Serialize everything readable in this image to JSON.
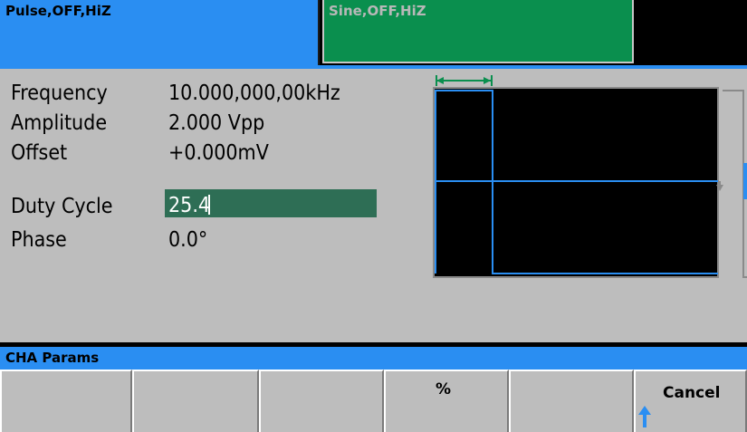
{
  "channels": {
    "cha_status": "Pulse,OFF,HiZ",
    "chb_status": "Sine,OFF,HiZ"
  },
  "params": {
    "frequency_label": "Frequency",
    "frequency_value": "10.000,000,00kHz",
    "amplitude_label": "Amplitude",
    "amplitude_value": "2.000 Vpp",
    "offset_label": "Offset",
    "offset_value": "+0.000mV",
    "duty_label": "Duty Cycle",
    "duty_value": "25.4",
    "phase_label": "Phase",
    "phase_value": "0.0°"
  },
  "menu": {
    "title": "CHA Params",
    "softkeys": [
      "",
      "",
      "",
      "%",
      "",
      "Cancel"
    ]
  },
  "colors": {
    "cha_blue": "#2a8ef2",
    "chb_green": "#0a8f4e",
    "edit_field": "#2e6e55",
    "panel_gray": "#bdbdbd"
  },
  "icons": {
    "cancel_arrow": "up-arrow-icon"
  }
}
